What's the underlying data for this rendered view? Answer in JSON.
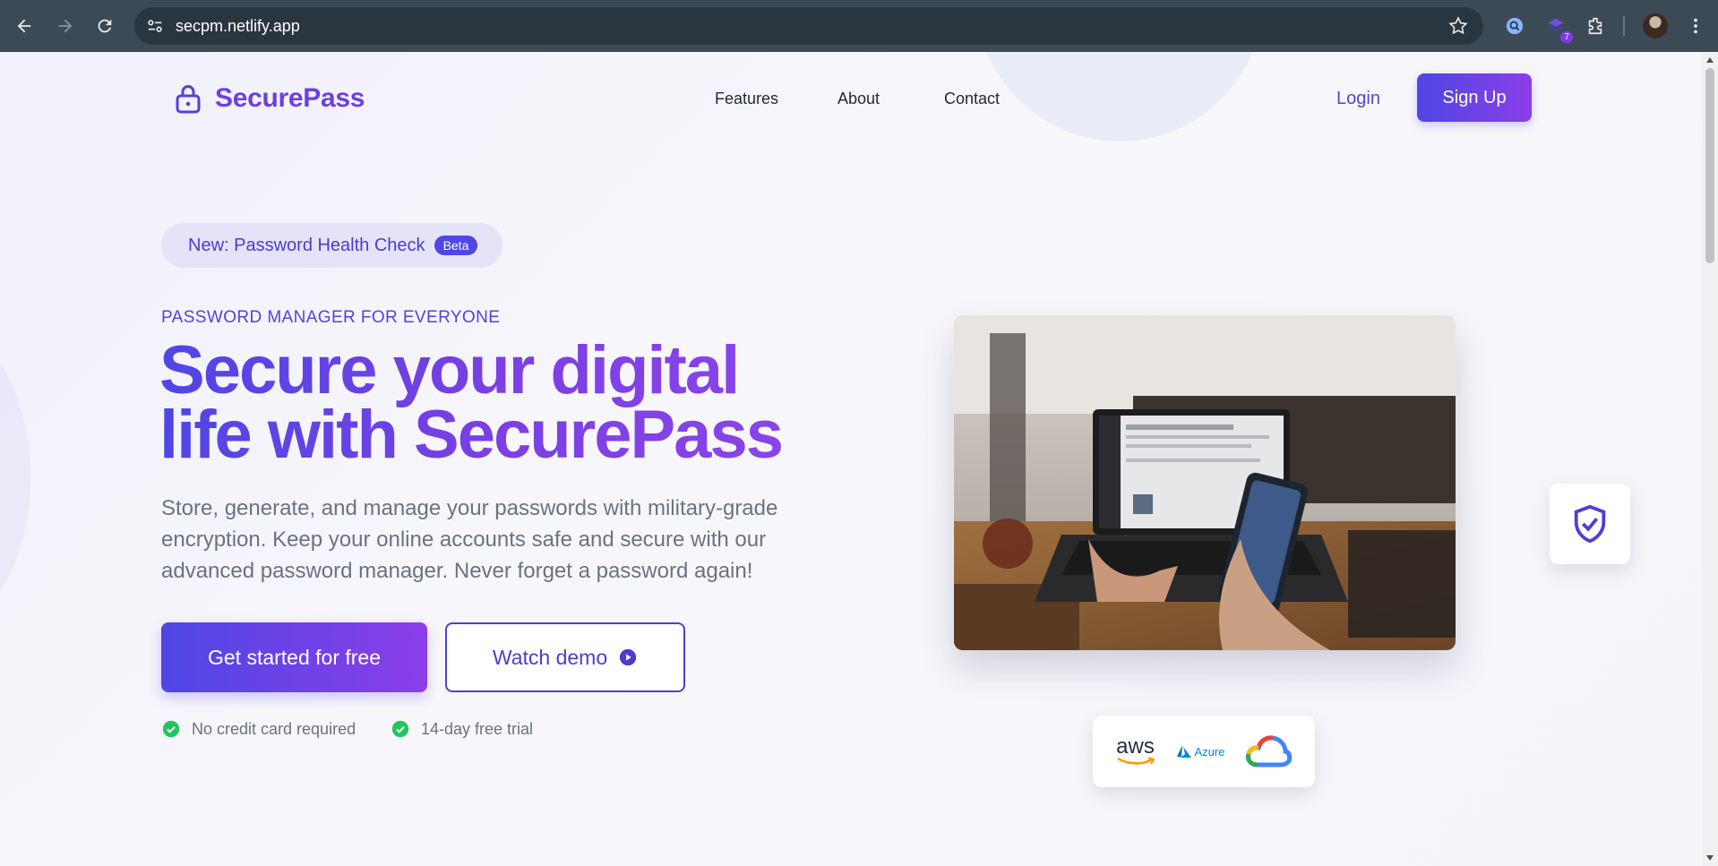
{
  "browser": {
    "url": "secpm.netlify.app",
    "extension_badge": "7"
  },
  "header": {
    "brand": "SecurePass",
    "nav": [
      "Features",
      "About",
      "Contact"
    ],
    "login_label": "Login",
    "signup_label": "Sign Up"
  },
  "hero": {
    "announcement": "New: Password Health Check",
    "announcement_badge": "Beta",
    "eyebrow": "PASSWORD MANAGER FOR EVERYONE",
    "headline_line1": "Secure your digital",
    "headline_line2": "life with SecurePass",
    "description": "Store, generate, and manage your passwords with military-grade encryption. Keep your online accounts safe and secure with our advanced password manager. Never forget a password again!",
    "cta_primary": "Get started for free",
    "cta_secondary": "Watch demo",
    "perks": [
      "No credit card required",
      "14-day free trial"
    ]
  },
  "cloud_logos": {
    "aws": "aws",
    "azure": "Azure",
    "gcp_icon": "google-cloud-icon"
  },
  "colors": {
    "brand": "#6d3fe0",
    "gradient_start": "#4f46e5",
    "gradient_end": "#8b3ee8",
    "success": "#22c55e"
  }
}
